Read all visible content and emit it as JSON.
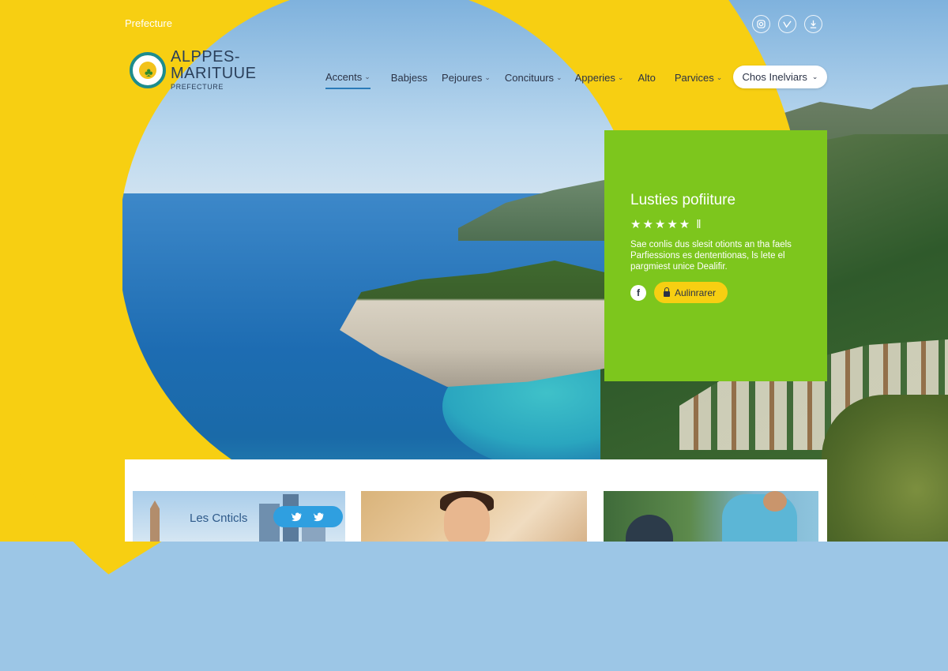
{
  "header": {
    "top_label": "Prefecture",
    "top_icons": [
      "instagram-icon",
      "vimeo-icon",
      "download-icon"
    ],
    "logo": {
      "line1": "ALPPES-",
      "line2": "MARITUUE",
      "sub": "PREFECTURE"
    },
    "nav": [
      {
        "label": "Accents",
        "dropdown": true,
        "active": true
      },
      {
        "label": "Babjess",
        "dropdown": false,
        "active": false
      },
      {
        "label": "Pejoures",
        "dropdown": true,
        "active": false
      },
      {
        "label": "Concituurs",
        "dropdown": true,
        "active": false
      },
      {
        "label": "Apperies",
        "dropdown": true,
        "active": false
      },
      {
        "label": "Alto",
        "dropdown": false,
        "active": false
      },
      {
        "label": "Parvices",
        "dropdown": true,
        "active": false
      }
    ],
    "cta_label": "Chos Inelviars"
  },
  "card": {
    "title": "Lusties pofiiture",
    "stars": "★★★★★ ‖",
    "body": "Sae conlis dus slesit otionts an tha faels Parfiessions es dententionas, ls lete el pargmiest unice Dealifir.",
    "button_label": "Aulinrarer",
    "color": "#7dc61d"
  },
  "tiles": {
    "tile1_title": "Les Cnticls"
  },
  "colors": {
    "accent_yellow": "#f7cf12",
    "card_green": "#7dc61d",
    "text_dark": "#2b3346",
    "nav_active": "#2a7ab8"
  }
}
